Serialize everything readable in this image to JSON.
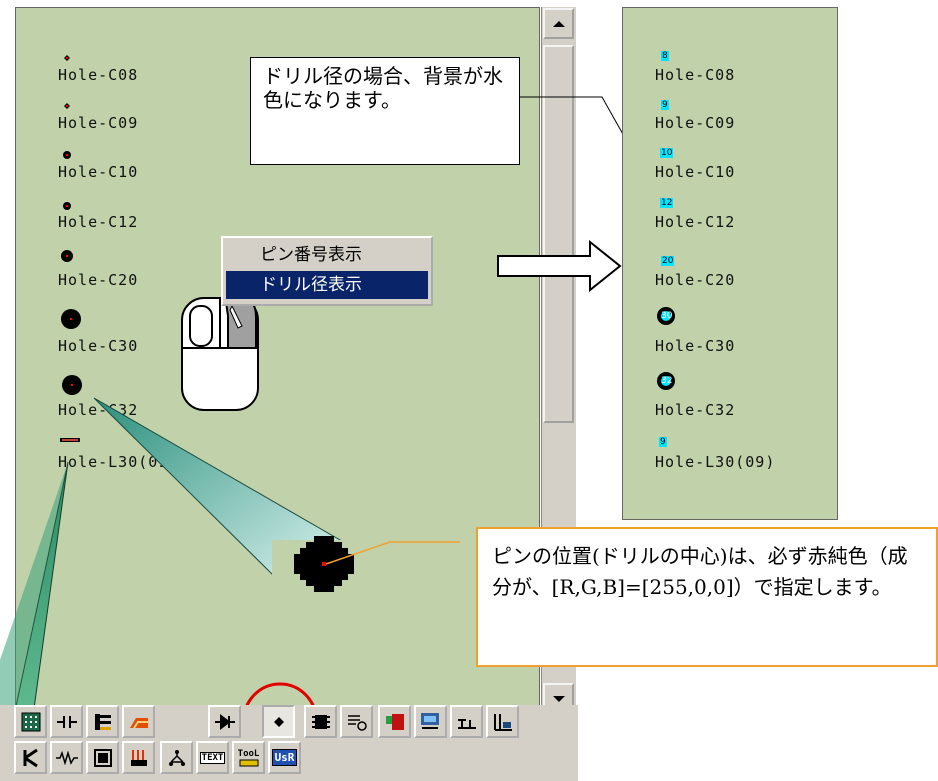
{
  "left_panel": {
    "holes": [
      {
        "label": "Hole-C08"
      },
      {
        "label": "Hole-C09"
      },
      {
        "label": "Hole-C10"
      },
      {
        "label": "Hole-C12"
      },
      {
        "label": "Hole-C20"
      },
      {
        "label": "Hole-C30"
      },
      {
        "label": "Hole-C32"
      },
      {
        "label": "Hole-L30(09)"
      }
    ]
  },
  "context_menu": {
    "items": [
      {
        "label": "ピン番号表示",
        "selected": false
      },
      {
        "label": "ドリル径表示",
        "selected": true
      }
    ]
  },
  "right_panel": {
    "holes": [
      {
        "label": "Hole-C08",
        "drill": "8"
      },
      {
        "label": "Hole-C09",
        "drill": "9"
      },
      {
        "label": "Hole-C10",
        "drill": "10"
      },
      {
        "label": "Hole-C12",
        "drill": "12"
      },
      {
        "label": "Hole-C20",
        "drill": "20"
      },
      {
        "label": "Hole-C30",
        "drill": "30"
      },
      {
        "label": "Hole-C32",
        "drill": "32"
      },
      {
        "label": "Hole-L30(09)",
        "drill": "9"
      }
    ]
  },
  "callouts": {
    "drill_note": "ドリル径の場合、背景が水色になります。",
    "pin_note": "ピンの位置(ドリルの中心)は、必ず赤純色（成分が、[R,G,B]=[255,0,0]）で指定します。"
  },
  "toolbar": {
    "row1": [
      "grid-icon",
      "capacitor-icon",
      "connector-icon",
      "connector2-icon",
      "diode-icon",
      "hole-icon",
      "ic-icon",
      "switch-icon",
      "led-icon",
      "module-icon",
      "jumper-icon",
      "pin-header-icon"
    ],
    "row2": [
      "transistor-icon",
      "resistor-icon",
      "relay-icon",
      "heater-icon",
      "network-icon"
    ],
    "text_label": "TEXT",
    "tool_label": "TooL",
    "user_label": "UsR"
  },
  "colors": {
    "canvas_bg": "#c1d1a9",
    "drill_bg": "#00e5ff",
    "pin_center": "#ff0000",
    "menu_highlight": "#0a246a",
    "pin_callout_border": "#f0a030",
    "highlight_circle": "#e00000"
  }
}
